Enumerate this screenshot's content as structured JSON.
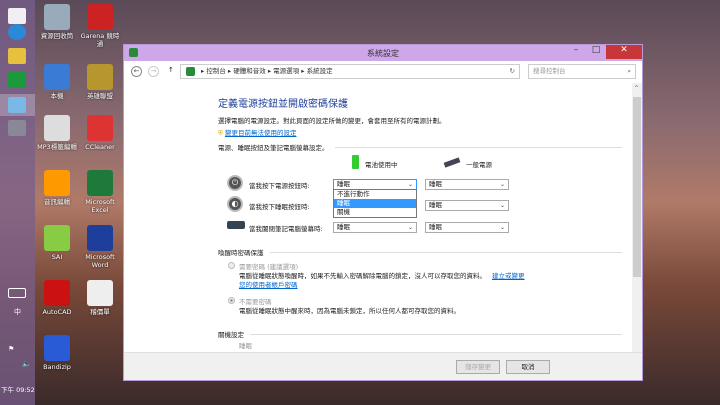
{
  "taskbar": {
    "time": "下午 09:52",
    "ime": "中"
  },
  "desktop": [
    {
      "label": "資源回收筒",
      "color": "#9ab"
    },
    {
      "label": "Garena 競時通",
      "color": "#c22"
    },
    {
      "label": "本機",
      "color": "#3a7bd5"
    },
    {
      "label": "英雄聯盟",
      "color": "#b8962e"
    },
    {
      "label": "MP3標籤編輯",
      "color": "#ddd"
    },
    {
      "label": "CCleaner",
      "color": "#d33"
    },
    {
      "label": "音訊編輯",
      "color": "#f90"
    },
    {
      "label": "Microsoft Excel",
      "color": "#1d7a3a"
    },
    {
      "label": "SAI",
      "color": "#8c4"
    },
    {
      "label": "Microsoft Word",
      "color": "#1d3e9a"
    },
    {
      "label": "AutoCAD",
      "color": "#c11"
    },
    {
      "label": "稽價單",
      "color": "#eee"
    },
    {
      "label": "Bandizip",
      "color": "#2a5bd7"
    }
  ],
  "window": {
    "title": "系統設定",
    "breadcrumb": [
      "控制台",
      "硬體和音效",
      "電源選項",
      "系統設定"
    ],
    "search_placeholder": "搜尋控制台",
    "heading": "定義電源按鈕並開啟密碼保護",
    "description": "選擇電腦的電源設定。對此頁面的設定所做的變更，會套用至所有的電源計劃。",
    "change_link": "變更目前無法使用的設定",
    "section_power": "電源、睡眠按鈕及筆記電腦螢幕設定。",
    "col_battery": "電池使用中",
    "col_plugged": "一般電源",
    "rows": [
      {
        "label": "當我按下電源按鈕時:",
        "battery": "睡眠",
        "plugged": "睡眠"
      },
      {
        "label": "當我按下睡眠按鈕時:",
        "battery": "睡眠",
        "plugged": "睡眠"
      },
      {
        "label": "當我闔閉筆記電腦螢幕時:",
        "battery": "睡眠",
        "plugged": "睡眠"
      }
    ],
    "dropdown_options": [
      "不進行動作",
      "睡眠",
      "關機"
    ],
    "section_wake": "喚醒時密碼保護",
    "opt_require": "需要密碼 (建議選項)",
    "opt_require_desc": "電腦從睡眠狀態喚醒時，如果不先輸入密碼解除電腦的鎖定，沒人可以存取您的資料。",
    "opt_require_link1": "建立或變更",
    "opt_require_link2": "您的使用者帳戶密碼",
    "opt_none": "不需要密碼",
    "opt_none_desc": "電腦從睡眠狀態中醒來時，因為電腦未鎖定，所以任何人都可存取您的資料。",
    "section_shutdown": "關機設定",
    "shutdown_item": "睡眠",
    "save": "儲存變更",
    "cancel": "取消"
  }
}
